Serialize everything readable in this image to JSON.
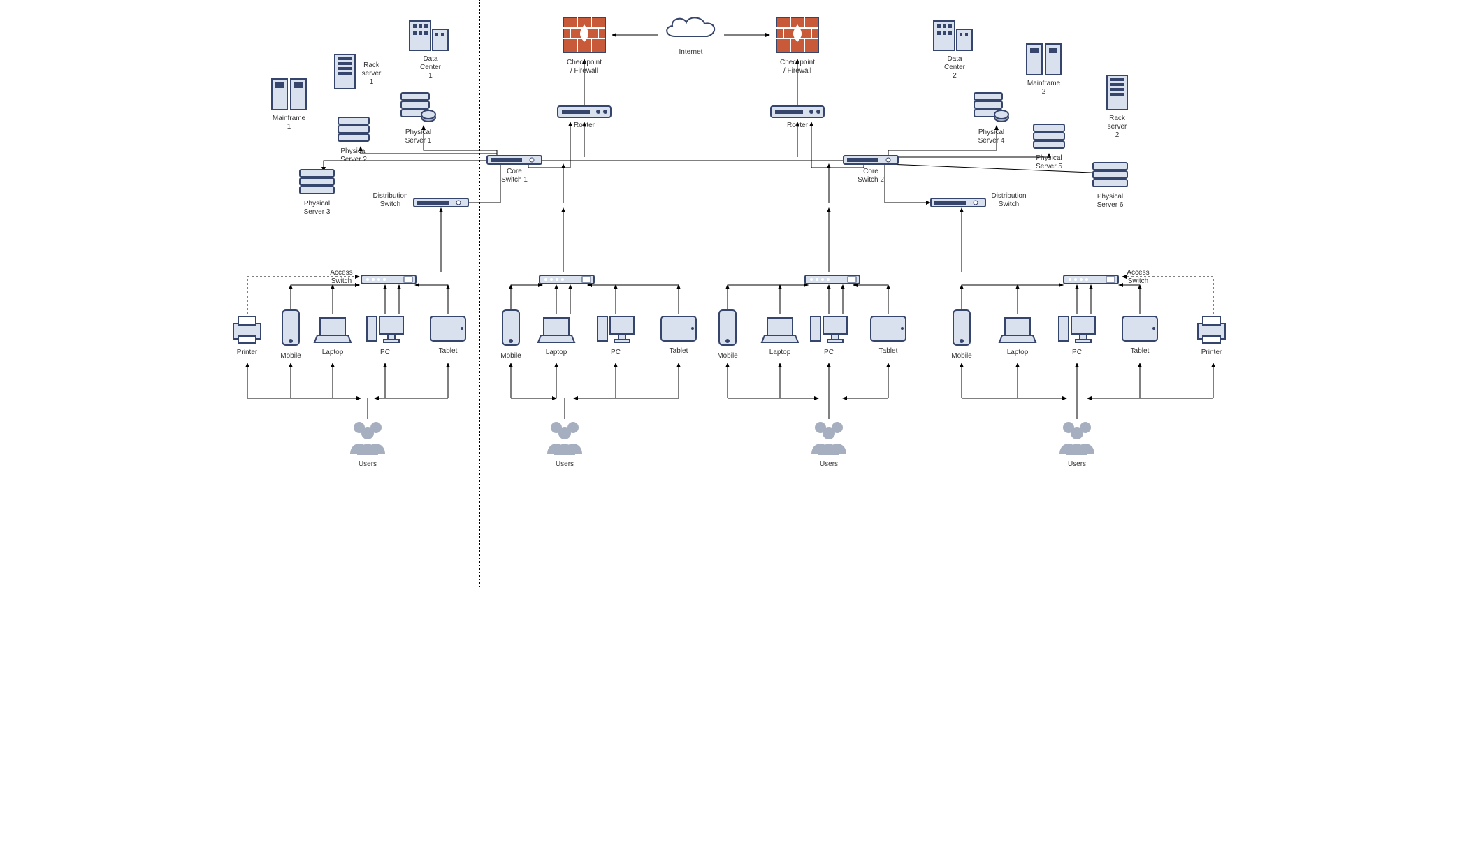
{
  "diagram": {
    "internet": "Internet",
    "firewall_left": "Checkpoint\n/ Firewall",
    "firewall_right": "Checkpoint\n/ Firewall",
    "router_left": "Router",
    "router_right": "Router",
    "core_switch_1": "Core\nSwitch 1",
    "core_switch_2": "Core\nSwitch 2",
    "dist_switch_left": "Distribution\nSwitch",
    "dist_switch_right": "Distribution\nSwitch",
    "access_switch": "Access\nSwitch",
    "mainframe_1": "Mainframe\n1",
    "mainframe_2": "Mainframe\n2",
    "rack_1": "Rack\nserver\n1",
    "rack_2": "Rack\nserver\n2",
    "dc_1": "Data\nCenter\n1",
    "dc_2": "Data\nCenter\n2",
    "ps1": "Physical\nServer 1",
    "ps2": "Physical\nServer 2",
    "ps3": "Physical\nServer 3",
    "ps4": "Physical\nServer 4",
    "ps5": "Physical\nServer 5",
    "ps6": "Physical\nServer 6",
    "printer": "Printer",
    "mobile": "Mobile",
    "laptop": "Laptop",
    "pc": "PC",
    "tablet": "Tablet",
    "users": "Users"
  }
}
